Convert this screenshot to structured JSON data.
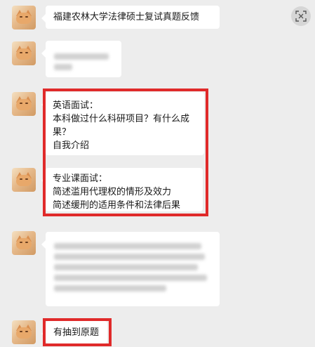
{
  "messages": [
    {
      "text": "福建农林大学法律硕士复试真题反馈"
    },
    {
      "blurred": true
    },
    {
      "lines": [
        "英语面试：",
        "本科做过什么科研项目？有什么成",
        "果？",
        "自我介绍"
      ]
    },
    {
      "lines": [
        "专业课面试：",
        "简述滥用代理权的情形及效力",
        "简述缓刑的适用条件和法律后果"
      ]
    },
    {
      "blurred": true
    },
    {
      "text": "有抽到原题"
    }
  ],
  "icons": {
    "top_right": "screenshot-scan-icon",
    "avatar": "cat-avatar"
  },
  "colors": {
    "background": "#ededed",
    "bubble": "#ffffff",
    "highlight": "#e02a2a"
  }
}
